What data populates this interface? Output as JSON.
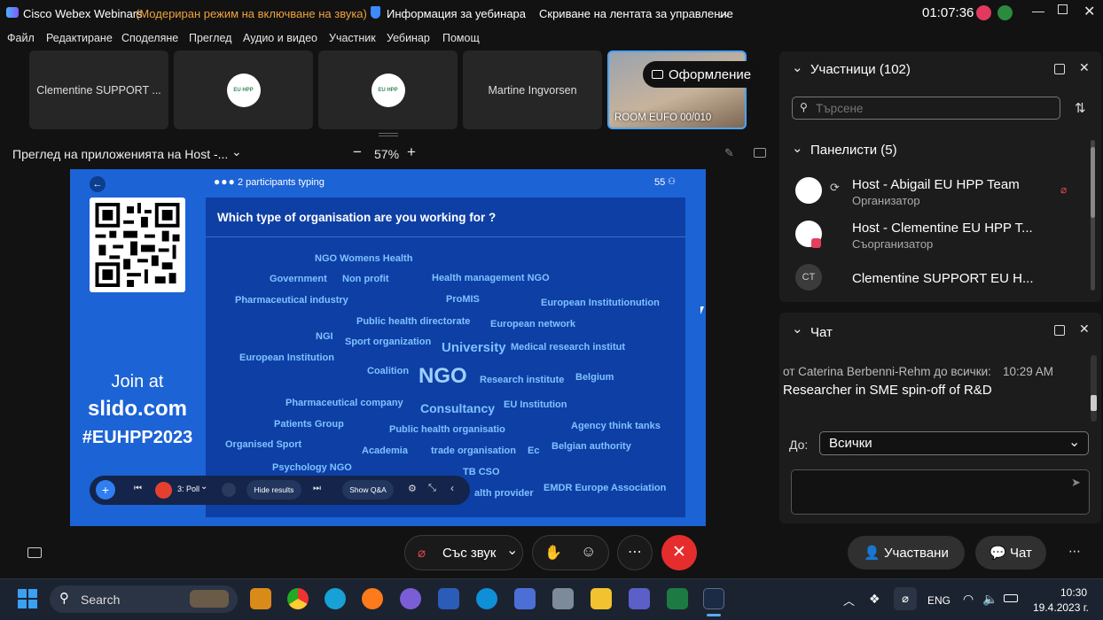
{
  "titlebar": {
    "app_name": "Cisco Webex Webinars",
    "mode_text": "(Модериран режим на включване на звука)",
    "webinar_info": "Информация за уебинара",
    "hide_controls": "Скриване на лентата за управление",
    "timer": "01:07:36",
    "window_controls": [
      "minimize-icon",
      "restore-icon",
      "close-icon"
    ]
  },
  "menu": [
    "Файл",
    "Редактиране",
    "Споделяне",
    "Преглед",
    "Аудио и видео",
    "Участник",
    "Уебинар",
    "Помощ"
  ],
  "tiles": [
    {
      "label": "Clementine SUPPORT  ..."
    },
    {
      "label": ""
    },
    {
      "label": ""
    },
    {
      "label": "Martine Ingvorsen"
    },
    {
      "label": "ROOM EUFO 00/010"
    }
  ],
  "layout_button": "Оформление",
  "share": {
    "title": "Преглед на приложенията на Host -...",
    "zoom": "57%"
  },
  "slido": {
    "typing": "2 participants typing",
    "count": "55",
    "question": "Which type of organisation are you working for ?",
    "join_text": "Join at",
    "site": "slido.com",
    "code": "#EUHPP2023",
    "poll_label": "3: Poll",
    "hide_results": "Hide results",
    "show_qa": "Show Q&A"
  },
  "wordcloud": [
    {
      "text": "NGO Womens Health",
      "size": 11
    },
    {
      "text": "Government",
      "size": 11
    },
    {
      "text": "Non profit",
      "size": 11
    },
    {
      "text": "Health management NGO",
      "size": 11
    },
    {
      "text": "Pharmaceutical industry",
      "size": 11
    },
    {
      "text": "ProMIS",
      "size": 11
    },
    {
      "text": "European Institutionution",
      "size": 11
    },
    {
      "text": "Public health directorate",
      "size": 11
    },
    {
      "text": "European network",
      "size": 11
    },
    {
      "text": "NGI",
      "size": 11
    },
    {
      "text": "Sport organization",
      "size": 11
    },
    {
      "text": "University",
      "size": 15
    },
    {
      "text": "Medical research institut",
      "size": 11
    },
    {
      "text": "European Institution",
      "size": 11
    },
    {
      "text": "Coalition",
      "size": 11
    },
    {
      "text": "NGO",
      "size": 24
    },
    {
      "text": "Research institute",
      "size": 11
    },
    {
      "text": "Belgium",
      "size": 11
    },
    {
      "text": "Pharmaceutical company",
      "size": 11
    },
    {
      "text": "Consultancy",
      "size": 14
    },
    {
      "text": "EU Institution",
      "size": 11
    },
    {
      "text": "Patients Group",
      "size": 11
    },
    {
      "text": "Agency think tanks",
      "size": 11
    },
    {
      "text": "Public health organisatio",
      "size": 11
    },
    {
      "text": "Organised Sport",
      "size": 11
    },
    {
      "text": "Academia",
      "size": 11
    },
    {
      "text": "trade organisation",
      "size": 11
    },
    {
      "text": "Ec",
      "size": 11
    },
    {
      "text": "Belgian authority",
      "size": 11
    },
    {
      "text": "Psychology NGO",
      "size": 11
    },
    {
      "text": "TB CSO",
      "size": 11
    },
    {
      "text": "alth provider",
      "size": 11
    },
    {
      "text": "EMDR Europe Association",
      "size": 11
    }
  ],
  "participants": {
    "header": "Участници (102)",
    "search_placeholder": "Търсене",
    "panelists_header": "Панелисти (5)",
    "items": [
      {
        "name": "Host - Abigail EU HPP Team",
        "role": "Организатор",
        "initials": ""
      },
      {
        "name": "Host - Clementine EU HPP T...",
        "role": "Съорганизатор",
        "initials": ""
      },
      {
        "name": "Clementine SUPPORT  EU H...",
        "role": "",
        "initials": "CT"
      }
    ]
  },
  "chat": {
    "header": "Чат",
    "sender": "от Caterina Berbenni-Rehm до всички:",
    "time": "10:29 AM",
    "message": "Researcher in SME spin-off of R&D",
    "to_label": "До:",
    "to_value": "Всички"
  },
  "controls": {
    "audio_label": "Със звук",
    "participants_btn": "Участвани",
    "chat_btn": "Чат"
  },
  "taskbar": {
    "search": "Search",
    "lang": "ENG",
    "time": "10:30",
    "date": "19.4.2023 г."
  },
  "colors": {
    "accent_blue": "#1c63d6",
    "end_red": "#e62d2d",
    "word_blue": "#7ec3ff"
  }
}
